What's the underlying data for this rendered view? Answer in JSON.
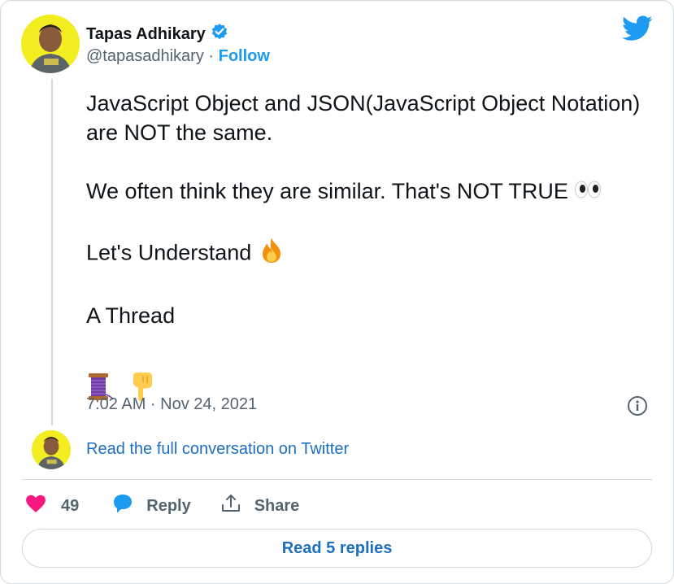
{
  "author": {
    "name": "Tapas Adhikary",
    "handle": "@tapasadhikary",
    "separator": "·",
    "follow_label": "Follow",
    "verified_icon": "verified-badge-icon",
    "avatar_bg": "#f2ee22"
  },
  "brand": {
    "icon": "twitter-bird-icon",
    "color": "#1d9bf0"
  },
  "tweet": {
    "line1": "JavaScript Object and JSON(JavaScript Object Notation) are NOT the same.",
    "line2": "We often think they are similar. That's NOT TRUE",
    "line2_emoji": "eyes-emoji",
    "line3": "Let's Understand",
    "line3_emoji": "fire-emoji",
    "line4": "A Thread",
    "line5_emojis": [
      "spool-of-thread-emoji",
      "backhand-index-pointing-down-emoji"
    ],
    "timestamp": "7:02 AM · Nov 24, 2021"
  },
  "conversation_link": "Read the full conversation on Twitter",
  "actions": {
    "like_count": "49",
    "reply_label": "Reply",
    "share_label": "Share",
    "like_color": "#f91880"
  },
  "read_replies_label": "Read 5 replies"
}
